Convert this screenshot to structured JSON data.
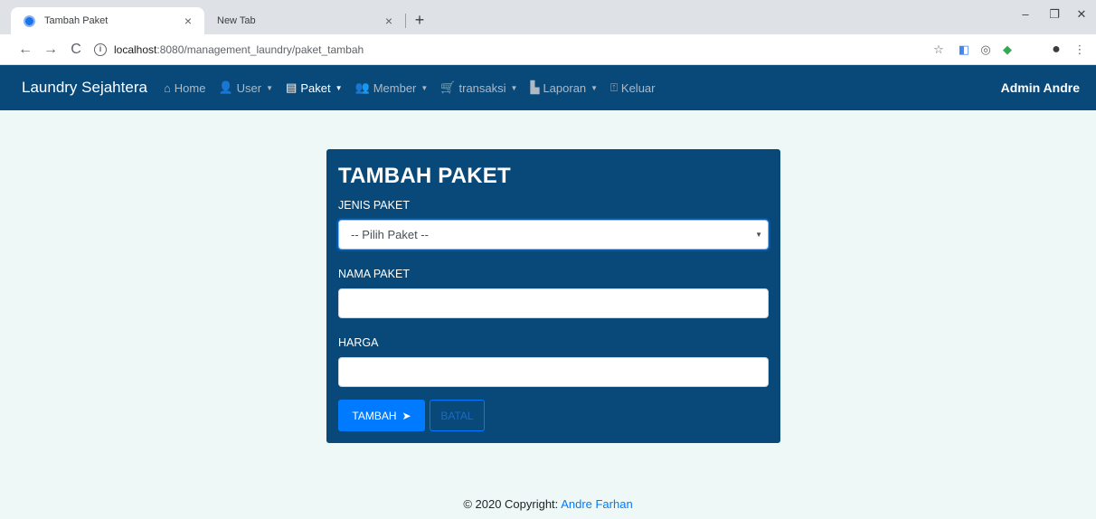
{
  "browser": {
    "tabs": [
      {
        "title": "Tambah Paket",
        "close": "×"
      },
      {
        "title": "New Tab",
        "close": "×"
      }
    ],
    "new_tab": "+",
    "window_controls": {
      "minimize": "–",
      "restore": "❐",
      "close": "✕"
    },
    "nav": {
      "back": "←",
      "forward": "→",
      "reload": "C"
    },
    "address": {
      "info_icon": "i",
      "host": "localhost",
      "path": ":8080/management_laundry/paket_tambah"
    },
    "toolbar_icons": {
      "star": "☆",
      "ext1": "◧",
      "ext2": "◎",
      "ext3": "◆",
      "profile": "●",
      "menu": "⋮"
    }
  },
  "navbar": {
    "brand": "Laundry Sejahtera",
    "items": [
      {
        "label": "Home",
        "icon": "home-icon",
        "glyph": "⌂"
      },
      {
        "label": "User",
        "icon": "user-icon",
        "glyph": "👤",
        "caret": "▼"
      },
      {
        "label": "Paket",
        "icon": "package-icon",
        "glyph": "▤",
        "caret": "▼"
      },
      {
        "label": "Member",
        "icon": "users-icon",
        "glyph": "👥",
        "caret": "▼"
      },
      {
        "label": "transaksi",
        "icon": "cart-icon",
        "glyph": "🛒",
        "caret": "▼"
      },
      {
        "label": "Laporan",
        "icon": "file-icon",
        "glyph": "▙",
        "caret": "▼"
      },
      {
        "label": "Keluar",
        "icon": "door-icon",
        "glyph": "⍐"
      }
    ],
    "user": "Admin Andre"
  },
  "form": {
    "title": "TAMBAH PAKET",
    "jenis_label": "JENIS PAKET",
    "jenis_selected": "-- Pilih Paket --",
    "nama_label": "NAMA PAKET",
    "nama_value": "",
    "harga_label": "HARGA",
    "harga_value": "",
    "submit_label": "TAMBAH",
    "submit_icon": "paper-plane-icon",
    "submit_glyph": "➤",
    "cancel_label": "BATAL"
  },
  "footer": {
    "text": "© 2020 Copyright: ",
    "link": "Andre Farhan"
  },
  "colors": {
    "navbar_bg": "#08497a",
    "page_bg": "#eef8f6",
    "primary": "#007bff"
  }
}
